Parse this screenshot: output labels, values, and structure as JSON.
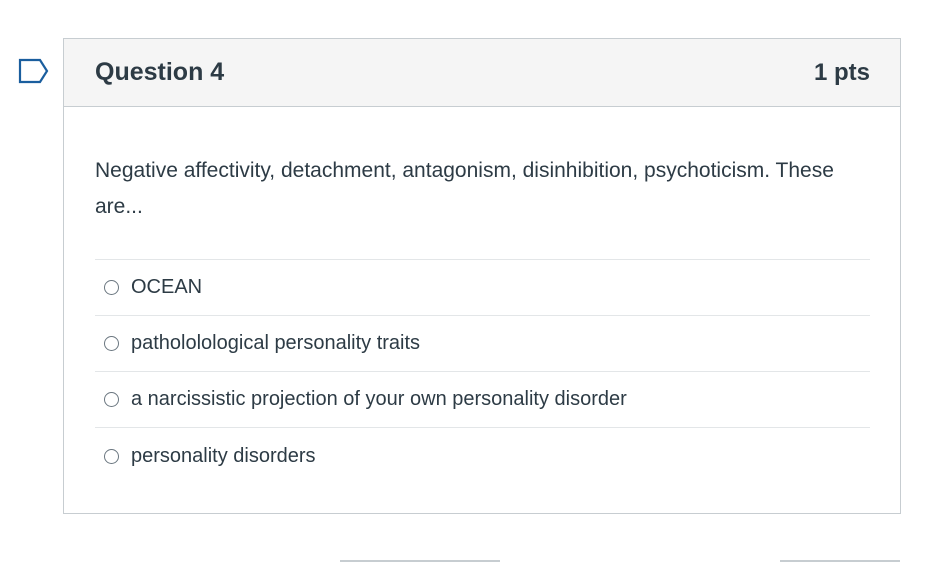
{
  "question": {
    "title": "Question 4",
    "points": "1 pts",
    "text": "Negative affectivity, detachment, antagonism, disinhibition, psychoticism. These are...",
    "answers": [
      {
        "label": "OCEAN",
        "selected": false
      },
      {
        "label": "pathololological personality traits",
        "selected": false
      },
      {
        "label": "a narcissistic projection of your own personality disorder",
        "selected": false
      },
      {
        "label": "personality disorders",
        "selected": false
      }
    ]
  },
  "colors": {
    "text": "#2d3b45",
    "header_bg": "#f5f5f5",
    "border": "#c7cdd1",
    "flag": "#1a5e9e"
  },
  "icons": {
    "flag": "bookmark-flag-icon"
  }
}
